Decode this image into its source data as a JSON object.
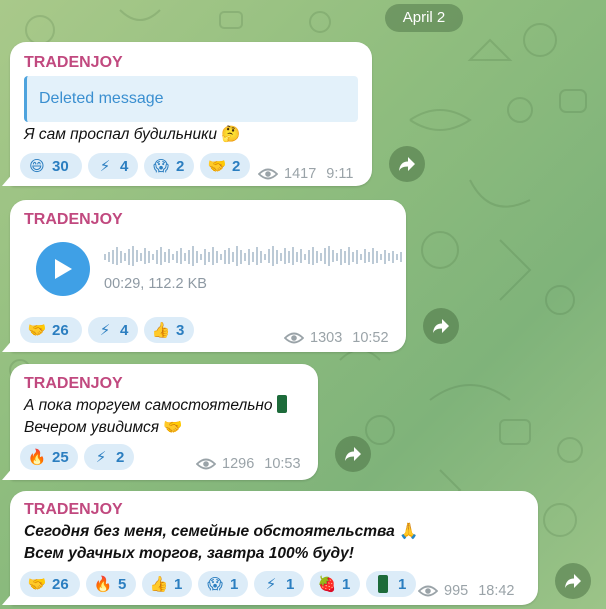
{
  "date_label": "April 2",
  "messages": [
    {
      "sender": "TRADENJOY",
      "reply_text": "Deleted message",
      "text": "Я сам проспал будильники",
      "text_emoji": "🤔",
      "reactions": [
        {
          "emoji": "😄",
          "count": "30"
        },
        {
          "emoji": "⚡",
          "count": "4"
        },
        {
          "emoji": "😱",
          "count": "2"
        },
        {
          "emoji": "🤝",
          "count": "2"
        }
      ],
      "views": "1417",
      "time": "9:11"
    },
    {
      "sender": "TRADENJOY",
      "voice_info": "00:29, 112.2 KB",
      "reactions": [
        {
          "emoji": "🤝",
          "count": "26"
        },
        {
          "emoji": "⚡",
          "count": "4"
        },
        {
          "emoji": "👍",
          "count": "3"
        }
      ],
      "views": "1303",
      "time": "10:52"
    },
    {
      "sender": "TRADENJOY",
      "text_line1": "А пока торгуем самостоятельно",
      "text_line2": "Вечером увидимся",
      "text_emoji2": "🤝",
      "reactions": [
        {
          "emoji": "🔥",
          "count": "25"
        },
        {
          "emoji": "⚡",
          "count": "2"
        }
      ],
      "views": "1296",
      "time": "10:53"
    },
    {
      "sender": "TRADENJOY",
      "text_line1": "Сегодня без меня, семейные обстоятельства",
      "text_emoji1": "🙏",
      "text_line2": "Всем удачных торгов, завтра 100% буду!",
      "reactions": [
        {
          "emoji": "🤝",
          "count": "26"
        },
        {
          "emoji": "🔥",
          "count": "5"
        },
        {
          "emoji": "👍",
          "count": "1"
        },
        {
          "emoji": "😱",
          "count": "1"
        },
        {
          "emoji": "⚡",
          "count": "1"
        },
        {
          "emoji": "🍓",
          "count": "1"
        },
        {
          "emoji": "candle",
          "count": "1"
        }
      ],
      "views": "995",
      "time": "18:42"
    }
  ],
  "colors": {
    "sender": "#c1497f",
    "reaction_bg": "#dcecf8",
    "reaction_text": "#2b7ec0",
    "play_button": "#3fa0e6"
  },
  "icons": {
    "views": "eye-icon",
    "forward": "forward-arrow-icon",
    "play": "play-icon"
  }
}
